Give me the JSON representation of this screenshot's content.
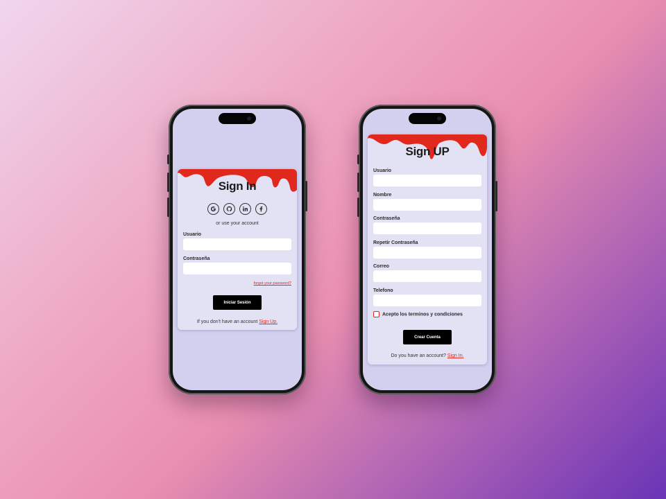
{
  "colors": {
    "accent": "#e0291c",
    "card": "#e3e2f5",
    "screen": "#d2d0ee",
    "button": "#000000"
  },
  "signin": {
    "title": "Sign In",
    "social_icons": [
      "google-icon",
      "github-icon",
      "linkedin-icon",
      "facebook-icon"
    ],
    "alt_text": "or use your account",
    "username_label": "Usuario",
    "username_value": "",
    "password_label": "Contraseña",
    "password_value": "",
    "forgot": "forgot your password?",
    "submit": "Iniciar Sesión",
    "footer_text": "If you don't have an account",
    "footer_link": "Sign Up."
  },
  "signup": {
    "title": "Sign UP",
    "fields": [
      {
        "label": "Usuario",
        "value": ""
      },
      {
        "label": "Nombre",
        "value": ""
      },
      {
        "label": "Contraseña",
        "value": ""
      },
      {
        "label": "Repetir Contraseña",
        "value": ""
      },
      {
        "label": "Correo",
        "value": ""
      },
      {
        "label": "Telefono",
        "value": ""
      }
    ],
    "terms": "Acepto los terminos y condiciones",
    "terms_checked": false,
    "submit": "Crear Cuenta",
    "footer_text": "Do you have an account?",
    "footer_link": "Sign In."
  }
}
